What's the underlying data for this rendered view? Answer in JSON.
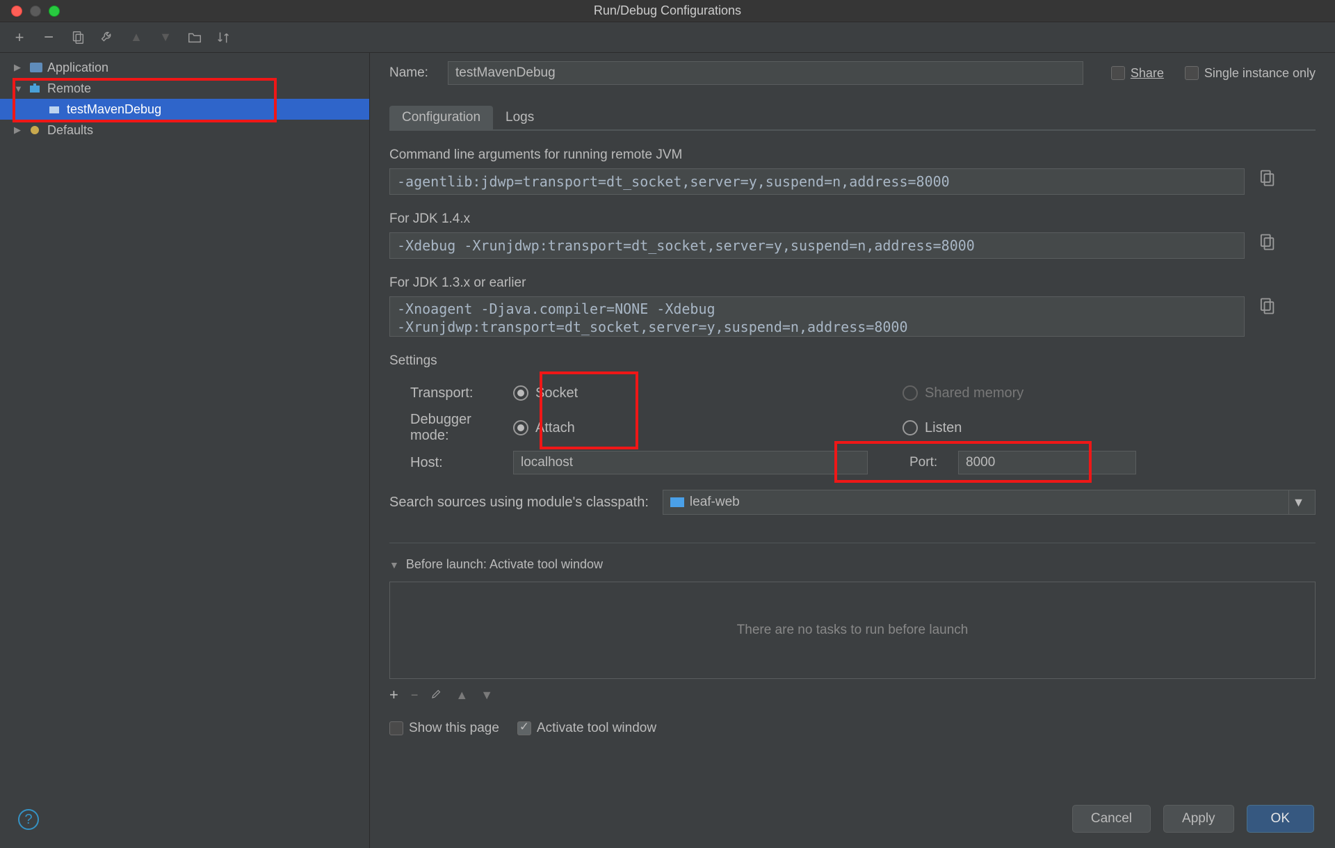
{
  "window": {
    "title": "Run/Debug Configurations"
  },
  "sidebar": {
    "items": [
      {
        "label": "Application",
        "expandable": true
      },
      {
        "label": "Remote",
        "expandable": true,
        "expanded": true
      },
      {
        "label": "testMavenDebug",
        "child": true,
        "selected": true
      },
      {
        "label": "Defaults",
        "expandable": true
      }
    ]
  },
  "form": {
    "name_label": "Name:",
    "name_value": "testMavenDebug",
    "share_label": "Share",
    "single_label": "Single instance only",
    "tabs": {
      "config": "Configuration",
      "logs": "Logs"
    },
    "cmd_caption": "Command line arguments for running remote JVM",
    "cmd_value": "-agentlib:jdwp=transport=dt_socket,server=y,suspend=n,address=8000",
    "jdk14_caption": "For JDK 1.4.x",
    "jdk14_value": "-Xdebug -Xrunjdwp:transport=dt_socket,server=y,suspend=n,address=8000",
    "jdk13_caption": "For JDK 1.3.x or earlier",
    "jdk13_line1": "-Xnoagent -Djava.compiler=NONE -Xdebug",
    "jdk13_line2": "-Xrunjdwp:transport=dt_socket,server=y,suspend=n,address=8000",
    "settings_hdr": "Settings",
    "transport_label": "Transport:",
    "transport_socket": "Socket",
    "transport_shared": "Shared memory",
    "mode_label": "Debugger mode:",
    "mode_attach": "Attach",
    "mode_listen": "Listen",
    "host_label": "Host:",
    "host_value": "localhost",
    "port_label": "Port:",
    "port_value": "8000",
    "classpath_label": "Search sources using module's classpath:",
    "classpath_value": "leaf-web",
    "before_launch": "Before launch: Activate tool window",
    "no_tasks": "There are no tasks to run before launch",
    "show_page": "Show this page",
    "activate_tool": "Activate tool window"
  },
  "buttons": {
    "cancel": "Cancel",
    "apply": "Apply",
    "ok": "OK"
  }
}
